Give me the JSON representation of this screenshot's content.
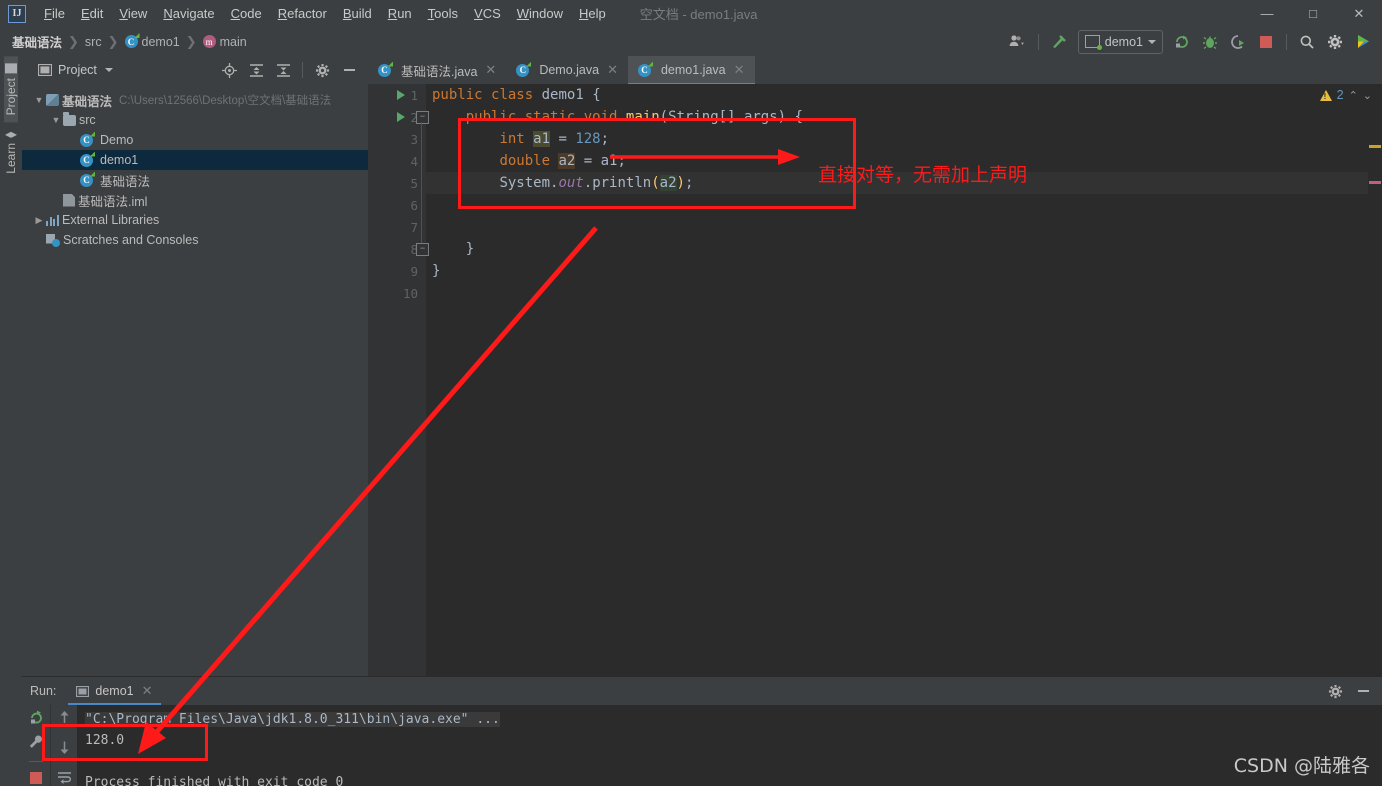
{
  "window": {
    "title": "空文档 - demo1.java",
    "minimize_label": "—",
    "maximize_label": "□",
    "close_label": "✕",
    "logo_label": "IJ"
  },
  "menubar": {
    "items": [
      {
        "label": "File",
        "mnemonic": "F"
      },
      {
        "label": "Edit",
        "mnemonic": "E"
      },
      {
        "label": "View",
        "mnemonic": "V"
      },
      {
        "label": "Navigate",
        "mnemonic": "N"
      },
      {
        "label": "Code",
        "mnemonic": "C"
      },
      {
        "label": "Refactor",
        "mnemonic": "R"
      },
      {
        "label": "Build",
        "mnemonic": "B"
      },
      {
        "label": "Run",
        "mnemonic": "R"
      },
      {
        "label": "Tools",
        "mnemonic": "T"
      },
      {
        "label": "VCS",
        "mnemonic": "V"
      },
      {
        "label": "Window",
        "mnemonic": "W"
      },
      {
        "label": "Help",
        "mnemonic": "H"
      }
    ]
  },
  "breadcrumb": {
    "items": [
      {
        "label": "基础语法",
        "icon": "none"
      },
      {
        "label": "src",
        "icon": "none"
      },
      {
        "label": "demo1",
        "icon": "class-icon"
      },
      {
        "label": "main",
        "icon": "method-icon"
      }
    ],
    "separator": "❯"
  },
  "toolbar": {
    "run_config": "demo1",
    "icons": [
      "user-account-icon",
      "build-hammer-icon",
      "run-icon",
      "debug-icon",
      "run-coverage-icon",
      "stop-icon",
      "search-icon",
      "settings-gear-icon",
      "updates-icon"
    ]
  },
  "left_strip": {
    "tabs": [
      {
        "label": "Project",
        "icon": "project-folder-icon",
        "active": true
      },
      {
        "label": "Learn",
        "icon": "graduation-cap-icon",
        "active": false
      }
    ]
  },
  "project_panel": {
    "title": "Project",
    "header_icons": [
      "locate-icon",
      "expand-all-icon",
      "collapse-all-icon",
      "settings-gear-icon",
      "hide-icon"
    ],
    "tree": [
      {
        "label": "基础语法",
        "path": "C:\\Users\\12566\\Desktop\\空文档\\基础语法",
        "indent": 0,
        "twist": "▼",
        "icon": "module-icon",
        "bold": true,
        "selected": false
      },
      {
        "label": "src",
        "path": "",
        "indent": 1,
        "twist": "▼",
        "icon": "source-folder-icon",
        "bold": false,
        "selected": false
      },
      {
        "label": "Demo",
        "path": "",
        "indent": 2,
        "twist": "",
        "icon": "class-icon",
        "bold": false,
        "selected": false
      },
      {
        "label": "demo1",
        "path": "",
        "indent": 2,
        "twist": "",
        "icon": "class-icon",
        "bold": false,
        "selected": true
      },
      {
        "label": "基础语法",
        "path": "",
        "indent": 2,
        "twist": "",
        "icon": "class-icon",
        "bold": false,
        "selected": false
      },
      {
        "label": "基础语法.iml",
        "path": "",
        "indent": 1,
        "twist": "",
        "icon": "iml-file-icon",
        "bold": false,
        "selected": false
      },
      {
        "label": "External Libraries",
        "path": "",
        "indent": 0,
        "twist": "▶",
        "icon": "library-icon",
        "bold": false,
        "selected": false
      },
      {
        "label": "Scratches and Consoles",
        "path": "",
        "indent": 0,
        "twist": "",
        "icon": "scratches-icon",
        "bold": false,
        "selected": false
      }
    ]
  },
  "editor": {
    "tabs": [
      {
        "label": "基础语法.java",
        "active": false,
        "close": "✕"
      },
      {
        "label": "Demo.java",
        "active": false,
        "close": "✕"
      },
      {
        "label": "demo1.java",
        "active": true,
        "close": "✕"
      }
    ],
    "line_numbers": [
      "1",
      "2",
      "3",
      "4",
      "5",
      "6",
      "7",
      "8",
      "9",
      "10"
    ],
    "highlighted_line": 5,
    "inspection": {
      "warning_count": "2",
      "up": "⌃",
      "down": "⌄"
    },
    "code_lines": [
      {
        "n": 1,
        "tokens": [
          {
            "t": "public",
            "c": "kw"
          },
          {
            "t": " ",
            "c": "pl"
          },
          {
            "t": "class",
            "c": "kw"
          },
          {
            "t": " ",
            "c": "pl"
          },
          {
            "t": "demo1",
            "c": "cls"
          },
          {
            "t": " ",
            "c": "pl"
          },
          {
            "t": "{",
            "c": "brace"
          }
        ]
      },
      {
        "n": 2,
        "tokens": [
          {
            "t": "    ",
            "c": "pl"
          },
          {
            "t": "public",
            "c": "kw"
          },
          {
            "t": " ",
            "c": "pl"
          },
          {
            "t": "static",
            "c": "kw"
          },
          {
            "t": " ",
            "c": "pl"
          },
          {
            "t": "void",
            "c": "kw"
          },
          {
            "t": " ",
            "c": "pl"
          },
          {
            "t": "main",
            "c": "par-y"
          },
          {
            "t": "(",
            "c": "brace"
          },
          {
            "t": "String",
            "c": "cls"
          },
          {
            "t": "[] ",
            "c": "pl"
          },
          {
            "t": "args",
            "c": "cls"
          },
          {
            "t": ") {",
            "c": "brace"
          }
        ]
      },
      {
        "n": 3,
        "tokens": [
          {
            "t": "        ",
            "c": "pl"
          },
          {
            "t": "int",
            "c": "kw"
          },
          {
            "t": " ",
            "c": "pl"
          },
          {
            "t": "a1",
            "c": "cls id-hl"
          },
          {
            "t": " = ",
            "c": "pl"
          },
          {
            "t": "128",
            "c": "num"
          },
          {
            "t": ";",
            "c": "pl"
          }
        ]
      },
      {
        "n": 4,
        "tokens": [
          {
            "t": "        ",
            "c": "pl"
          },
          {
            "t": "double",
            "c": "kw"
          },
          {
            "t": " ",
            "c": "pl"
          },
          {
            "t": "a2",
            "c": "cls id-hl2"
          },
          {
            "t": " = ",
            "c": "pl"
          },
          {
            "t": "a1",
            "c": "cls"
          },
          {
            "t": ";",
            "c": "pl"
          }
        ]
      },
      {
        "n": 5,
        "tokens": [
          {
            "t": "        ",
            "c": "pl"
          },
          {
            "t": "System",
            "c": "cls"
          },
          {
            "t": ".",
            "c": "pl"
          },
          {
            "t": "out",
            "c": "fld"
          },
          {
            "t": ".",
            "c": "pl"
          },
          {
            "t": "println",
            "c": "cls"
          },
          {
            "t": "(",
            "c": "par-y"
          },
          {
            "t": "a2",
            "c": "cls id-hl3"
          },
          {
            "t": ")",
            "c": "par-y"
          },
          {
            "t": ";",
            "c": "pl"
          }
        ]
      },
      {
        "n": 6,
        "tokens": []
      },
      {
        "n": 7,
        "tokens": []
      },
      {
        "n": 8,
        "tokens": [
          {
            "t": "    }",
            "c": "brace"
          }
        ]
      },
      {
        "n": 9,
        "tokens": [
          {
            "t": "}",
            "c": "brace"
          }
        ]
      },
      {
        "n": 10,
        "tokens": []
      }
    ]
  },
  "run_panel": {
    "label": "Run:",
    "tab": "demo1",
    "tab_close": "✕",
    "header_icons": [
      "settings-gear-icon",
      "hide-icon"
    ],
    "toolbar_icons": [
      "rerun-icon",
      "wrench-icon",
      "stop-icon"
    ],
    "toolbar2_icons": [
      "scroll-up-icon",
      "scroll-down-icon",
      "soft-wrap-icon"
    ],
    "console_lines": [
      {
        "text": "\"C:\\Program Files\\Java\\jdk1.8.0_311\\bin\\java.exe\" ...",
        "style": "cmd"
      },
      {
        "text": "128.0",
        "style": "out"
      },
      {
        "text": "",
        "style": "out"
      },
      {
        "text": "Process finished with exit code 0",
        "style": "out"
      }
    ]
  },
  "annotations": {
    "color": "#ff1a1a",
    "note_text": "直接对等，无需加上声明",
    "boxes": [
      "code-block-box",
      "console-output-box",
      "down-arrow-box"
    ],
    "arrows": [
      "horizontal-arrow-to-note",
      "diagonal-arrow-to-console"
    ]
  },
  "watermark": {
    "text": "CSDN @陆雅各"
  }
}
